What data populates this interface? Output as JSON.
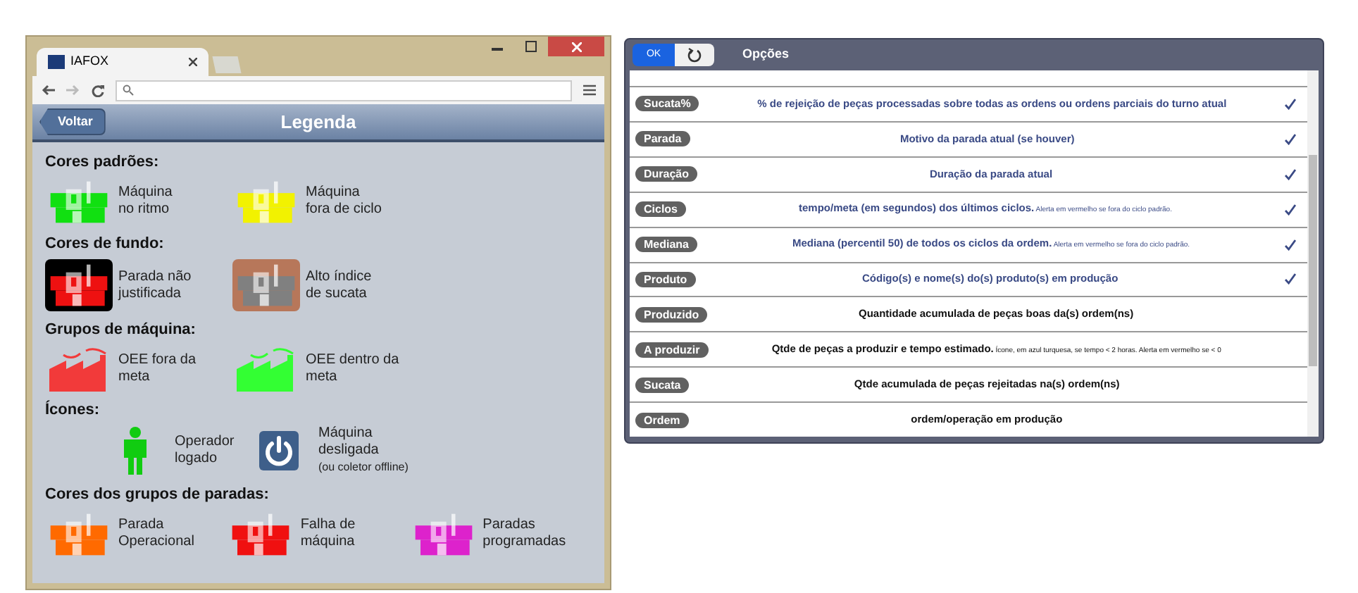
{
  "browser": {
    "tab_title": "IAFOX"
  },
  "legend": {
    "back_label": "Voltar",
    "title": "Legenda",
    "sections": [
      {
        "title": "Cores padrões:",
        "items": [
          {
            "kind": "machine",
            "color": "#11e011",
            "lines": [
              "Máquina",
              "no ritmo"
            ]
          },
          {
            "kind": "machine",
            "color": "#f2f200",
            "lines": [
              "Máquina",
              "fora de ciclo"
            ]
          }
        ]
      },
      {
        "title": "Cores de fundo:",
        "items": [
          {
            "kind": "machine",
            "color": "#ee1111",
            "tile": {
              "color": "#000000"
            },
            "lines": [
              "Parada não",
              "justificada"
            ]
          },
          {
            "kind": "machine",
            "color": "#808080",
            "tile": {
              "color": "#b7775a"
            },
            "lines": [
              "Alto índice",
              "de sucata"
            ]
          }
        ]
      },
      {
        "title": "Grupos de máquina:",
        "items": [
          {
            "kind": "factory",
            "color": "#f23a3a",
            "lines": [
              "OEE fora da",
              "meta"
            ]
          },
          {
            "kind": "factory",
            "color": "#33ff33",
            "lines": [
              "OEE dentro da",
              "meta"
            ]
          }
        ]
      },
      {
        "title": "Ícones:",
        "items": [
          {
            "kind": "person",
            "color": "#11cc11",
            "lines": [
              "Operador",
              "logado"
            ]
          },
          {
            "kind": "power",
            "color": "#3e5f8a",
            "lines": [
              "Máquina",
              "desligada"
            ],
            "note": "(ou coletor offline)"
          }
        ]
      },
      {
        "title": "Cores dos grupos de paradas:",
        "items": [
          {
            "kind": "machine",
            "color": "#ff6a00",
            "lines": [
              "Parada",
              "Operacional"
            ]
          },
          {
            "kind": "machine",
            "color": "#f01010",
            "lines": [
              "Falha de",
              "máquina"
            ]
          },
          {
            "kind": "machine",
            "color": "#dd22cc",
            "lines": [
              "Paradas",
              "programadas"
            ]
          }
        ]
      }
    ]
  },
  "options": {
    "ok_label": "OK",
    "title": "Opções",
    "rows": [
      {
        "tag": "Sucata%",
        "text": "% de rejeição de peças processadas sobre todas as ordens ou ordens parciais do turno atual",
        "checked": true
      },
      {
        "tag": "Parada",
        "text": "Motivo da parada atual (se houver)",
        "checked": true
      },
      {
        "tag": "Duração",
        "text": "Duração da parada atual",
        "checked": true
      },
      {
        "tag": "Ciclos",
        "text": "tempo/meta (em segundos) dos últimos ciclos.",
        "note": "Alerta em vermelho se fora do ciclo padrão.",
        "checked": true
      },
      {
        "tag": "Mediana",
        "text": "Mediana (percentil 50) de todos os ciclos da ordem.",
        "note": "Alerta em vermelho se fora do ciclo padrão.",
        "checked": true
      },
      {
        "tag": "Produto",
        "text": "Código(s) e nome(s) do(s) produto(s) em produção",
        "checked": true
      },
      {
        "tag": "Produzido",
        "text": "Quantidade acumulada de peças boas da(s) ordem(ns)",
        "checked": false
      },
      {
        "tag": "A produzir",
        "text": "Qtde de peças a produzir e tempo estimado.",
        "note": "Ícone, em azul turquesa, se tempo < 2 horas. Alerta em vermelho se < 0",
        "checked": false
      },
      {
        "tag": "Sucata",
        "text": "Qtde acumulada de peças rejeitadas na(s) ordem(ns)",
        "checked": false
      },
      {
        "tag": "Ordem",
        "text": "ordem/operação em produção",
        "checked": false
      }
    ]
  }
}
